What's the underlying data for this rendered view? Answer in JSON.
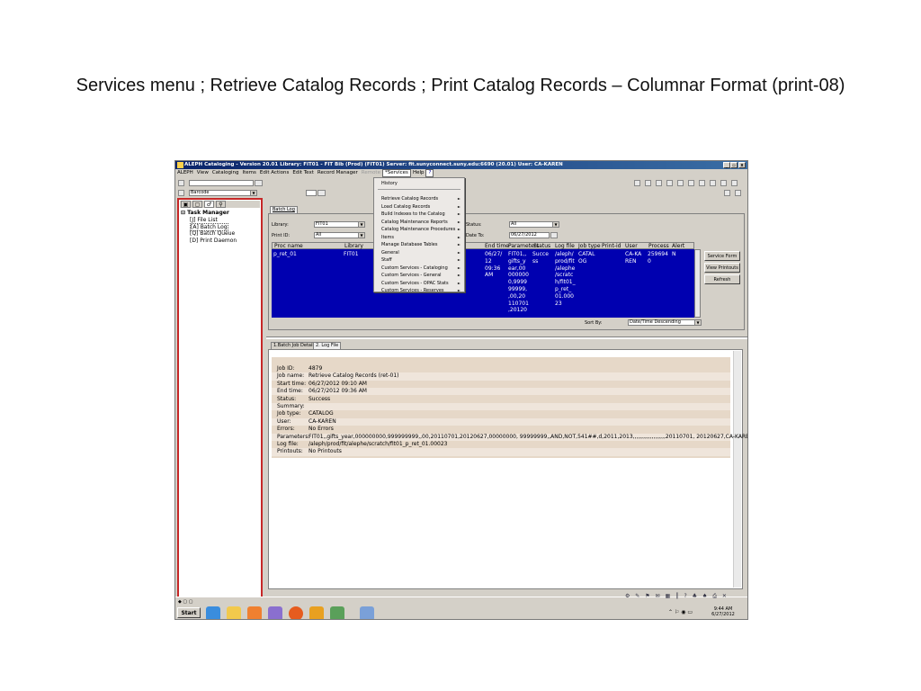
{
  "slide_title": "Services menu ; Retrieve Catalog  Records ; Print Catalog Records – Columnar Format (print-08)",
  "window": {
    "title": "ALEPH Cataloging - Version 20.01  Library: FIT01 - FIT Bib (Prod) (FIT01)  Server: fit.sunyconnect.suny.edu:6690 (20.01)  User: CA-KAREN",
    "controls": [
      "_",
      "▫",
      "x"
    ]
  },
  "menubar": [
    "ALEPH",
    "View",
    "Cataloging",
    "Items",
    "Edit Actions",
    "Edit Text",
    "Record Manager",
    "Remote",
    "*Services",
    "Help",
    "?"
  ],
  "toolbar": {
    "search_type": "Barcode"
  },
  "left_panel": {
    "tabs": [
      "▣",
      "▢",
      "♂",
      "⚲"
    ],
    "tree_root": "Task Manager",
    "tree_items": [
      "[J] File List",
      "[A] Batch Log",
      "[Q] Batch Queue",
      "[D] Print Daemon"
    ]
  },
  "batch": {
    "tab": "Batch Log",
    "library_label": "Library:",
    "library_value": "FIT01",
    "printid_label": "Print ID:",
    "printid_value": "All",
    "status_label": "Status:",
    "status_value": "All",
    "dateto_label": "Date To:",
    "dateto_value": "06/27/2012",
    "columns": [
      "Proc name",
      "Library",
      "",
      "End time",
      "Parameters",
      "Status",
      "Log file",
      "Job type",
      "Print-id",
      "User",
      "Process",
      "Alert"
    ],
    "row": {
      "proc_name": "p_ret_01",
      "library": "FIT01",
      "end_time": "06/27/\n12\n09:36\nAM",
      "parameters": "FIT01,,\ngifts_y\near,00\n000000\n0,9999\n99999,\n,00,20\n110701\n,20120",
      "status": "Succe\nss",
      "log_file": "/aleph/\nprod/fit\n/alephe\n/scratc\nh/fit01_\np_ret_\n01.000\n23",
      "job_type": "CATAL\nOG",
      "user": "CA-KA\nREN",
      "process": "259694\n0",
      "alert": "N"
    },
    "buttons": [
      "Service Form",
      "View Printouts",
      "Refresh"
    ],
    "sort_label": "Sort By:",
    "sort_value": "Date/Time Descending"
  },
  "services_menu": {
    "items": [
      {
        "label": "History",
        "sub": false
      },
      {
        "label": "Retrieve Catalog Records",
        "sub": true
      },
      {
        "label": "Load Catalog Records",
        "sub": true
      },
      {
        "label": "Build Indexes to the Catalog",
        "sub": true
      },
      {
        "label": "Catalog Maintenance Reports",
        "sub": true
      },
      {
        "label": "Catalog Maintenance Procedures",
        "sub": true
      },
      {
        "label": "Items",
        "sub": true
      },
      {
        "label": "Manage Database Tables",
        "sub": true
      },
      {
        "label": "General",
        "sub": true
      },
      {
        "label": "Staff",
        "sub": true
      },
      {
        "label": "Custom Services - Cataloging",
        "sub": true
      },
      {
        "label": "Custom Services - General",
        "sub": true
      },
      {
        "label": "Custom Services - OPAC Stats",
        "sub": true
      },
      {
        "label": "Custom Services - Reserves",
        "sub": true
      }
    ]
  },
  "detail_tabs": [
    "1.Batch Job Details",
    "2. Log File"
  ],
  "details": [
    {
      "label": "Job ID:",
      "value": "4879"
    },
    {
      "label": "Job name:",
      "value": "Retrieve Catalog Records (ret-01)"
    },
    {
      "label": "Start time:",
      "value": "06/27/2012 09:10 AM"
    },
    {
      "label": "End time:",
      "value": "06/27/2012 09:36 AM"
    },
    {
      "label": "Status:",
      "value": "Success"
    },
    {
      "label": "Summary:",
      "value": ""
    },
    {
      "label": "Job type:",
      "value": "CATALOG"
    },
    {
      "label": "User:",
      "value": "CA-KAREN"
    },
    {
      "label": "Errors:",
      "value": "No Errors"
    },
    {
      "label": "Parameters:",
      "value": "FIT01,,gifts_year,000000000,999999999,,00,20110701,20120627,00000000, 99999999,,AND,NOT,541##,d,2011,2013,,,,,,,,,,,,,,,,,,,20110701, 20120627,CA-KAREN,"
    },
    {
      "label": "Log file:",
      "value": "/aleph/prod/fit/alephe/scratch/fit01_p_ret_01.00023"
    },
    {
      "label": "Printouts:",
      "value": "No Printouts"
    }
  ],
  "taskbar": {
    "start_label": "Start",
    "time": "9:44 AM",
    "date": "6/27/2012"
  }
}
